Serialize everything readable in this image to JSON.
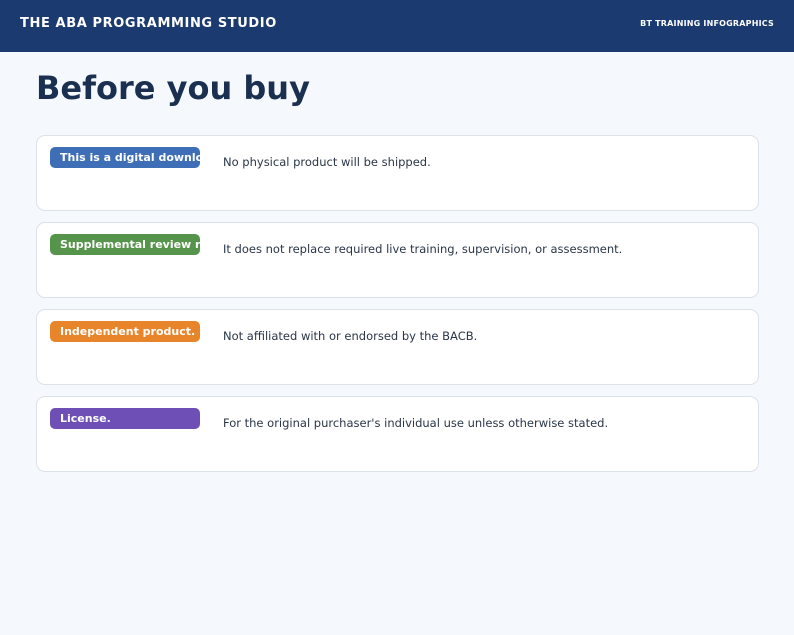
{
  "header": {
    "brand": "THE ABA PROGRAMMING STUDIO",
    "tagline": "BT TRAINING INFOGRAPHICS",
    "background_color": "#1b3a6f"
  },
  "page": {
    "title": "Before you buy"
  },
  "notices": [
    {
      "badge": "This is a digital download.",
      "text": "No physical product will be shipped.",
      "color": "#3d6eb6"
    },
    {
      "badge": "Supplemental review resource.",
      "text": "It does not replace required live training, supervision, or assessment.",
      "color": "#57944b"
    },
    {
      "badge": "Independent product.",
      "text": "Not affiliated with or endorsed by the BACB.",
      "color": "#e8852a"
    },
    {
      "badge": "License.",
      "text": "For the original purchaser's individual use unless otherwise stated.",
      "color": "#6d4fb5"
    }
  ]
}
